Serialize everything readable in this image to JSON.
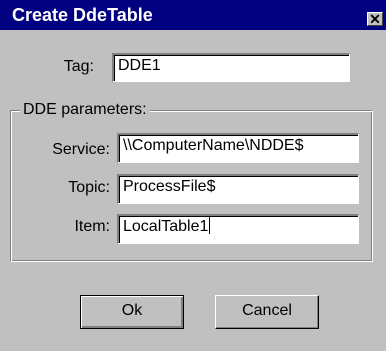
{
  "window": {
    "title": "Create DdeTable",
    "close_glyph": "✕"
  },
  "fields": {
    "tag": {
      "label": "Tag:",
      "value": "DDE1"
    },
    "service": {
      "label": "Service:",
      "value": "\\\\ComputerName\\NDDE$"
    },
    "topic": {
      "label": "Topic:",
      "value": "ProcessFile$"
    },
    "item": {
      "label": "Item:",
      "value": "LocalTable1"
    }
  },
  "group": {
    "label": "DDE parameters:"
  },
  "buttons": {
    "ok": "Ok",
    "cancel": "Cancel"
  },
  "icons": {
    "close": "close-icon"
  },
  "colors": {
    "titlebar": "#000080",
    "face": "#c0c0c0",
    "field": "#ffffff"
  }
}
